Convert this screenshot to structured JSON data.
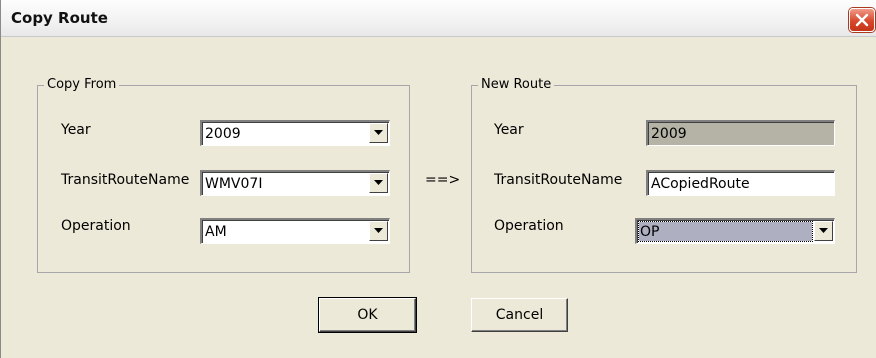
{
  "window": {
    "title": "Copy Route",
    "close_icon": "close-icon"
  },
  "copy_from": {
    "caption": "Copy From",
    "year_label": "Year",
    "year_value": "2009",
    "route_label": "TransitRouteName",
    "route_value": "WMV07I",
    "operation_label": "Operation",
    "operation_value": "AM"
  },
  "arrow": "==>",
  "new_route": {
    "caption": "New Route",
    "year_label": "Year",
    "year_value": "2009",
    "route_label": "TransitRouteName",
    "route_value": "ACopiedRoute",
    "operation_label": "Operation",
    "operation_value": "OP"
  },
  "buttons": {
    "ok": "OK",
    "cancel": "Cancel"
  },
  "colors": {
    "close_button": "#d8482c",
    "dialog_background": "#ece9d8",
    "disabled_field": "#b5b2a6",
    "selected_highlight": "#aeb0c2"
  }
}
